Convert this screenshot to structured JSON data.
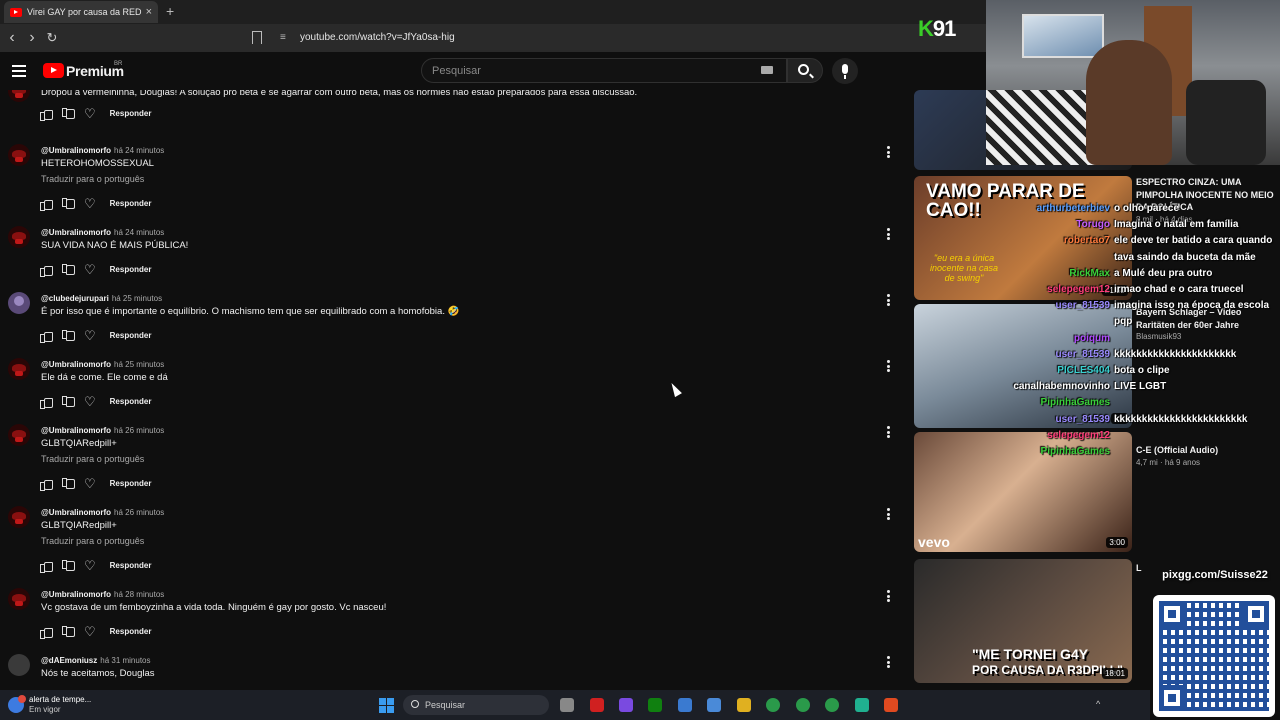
{
  "browser": {
    "tab_title": "Virei GAY por causa da REDPILL",
    "tab_close": "×",
    "new_tab": "+",
    "back": "‹",
    "forward": "›",
    "reload": "↻",
    "site_icon": "≡",
    "url": "youtube.com/watch?v=JfYa0sa-hig"
  },
  "youtube": {
    "brand": "Premium",
    "country": "BR",
    "search_placeholder": "Pesquisar"
  },
  "comments": [
    {
      "avatar": "red",
      "user": "",
      "time": "",
      "text": "Dropou a vermelhinha, Douglas! A solução pro beta é se agarrar com outro beta, mas os normies não estão preparados para essa discussão.",
      "translate": "",
      "reply": "Responder",
      "kebab": false
    },
    {
      "avatar": "red",
      "user": "@Umbralinomorfo",
      "time": "há 24 minutos",
      "text": "HETEROHOMOSSEXUAL",
      "translate": "Traduzir para o português",
      "reply": "Responder",
      "kebab": true
    },
    {
      "avatar": "red",
      "user": "@Umbralinomorfo",
      "time": "há 24 minutos",
      "text": "SUA VIDA NAO É MAIS PÚBLICA!",
      "translate": "",
      "reply": "Responder",
      "kebab": true
    },
    {
      "avatar": "purple",
      "user": "@clubedejurupari",
      "time": "há 25 minutos",
      "text": "É por isso que é importante o equilíbrio. O machismo tem que ser equilibrado com a homofobia. 🤣",
      "translate": "",
      "reply": "Responder",
      "kebab": true
    },
    {
      "avatar": "red",
      "user": "@Umbralinomorfo",
      "time": "há 25 minutos",
      "text": "Ele dá e come. Ele come e dá",
      "translate": "",
      "reply": "Responder",
      "kebab": true
    },
    {
      "avatar": "red",
      "user": "@Umbralinomorfo",
      "time": "há 26 minutos",
      "text": "GLBTQIARedpill+",
      "translate": "Traduzir para o português",
      "reply": "Responder",
      "kebab": true
    },
    {
      "avatar": "red",
      "user": "@Umbralinomorfo",
      "time": "há 26 minutos",
      "text": "GLBTQIARedpill+",
      "translate": "Traduzir para o português",
      "reply": "Responder",
      "kebab": true
    },
    {
      "avatar": "red",
      "user": "@Umbralinomorfo",
      "time": "há 28 minutos",
      "text": "Vc gostava de um femboyzinha a vida toda. Ninguém é gay por gosto. Vc nasceu!",
      "translate": "",
      "reply": "Responder",
      "kebab": true
    },
    {
      "avatar": "grey",
      "user": "@dAEmoniusz",
      "time": "há 31 minutos",
      "text": "Nós te aceitamos, Douglas",
      "translate": "",
      "reply": "",
      "kebab": true
    }
  ],
  "videos": [
    {
      "thumb_text": "G",
      "duration": "",
      "title": "",
      "meta": ""
    },
    {
      "thumb_text": "VAMO PARAR DE CAO!!",
      "quote": "\"eu era a única inocente na casa de swing\"",
      "duration": "21:39",
      "title": "ESPECTRO CINZA: UMA PIMPOLHA INOCENTE NO MEIO DA POLÍTICA",
      "meta": "8 mil · há 4 dias"
    },
    {
      "duration": "19:",
      "title": "Bayern Schlager – Video Raritäten der 60er Jahre",
      "meta": "Blasmusik93"
    },
    {
      "thumb_text": "vevo",
      "duration": "3:00",
      "title": "C-E (Official Audio)",
      "meta": "4,7 mi · há 9 anos"
    },
    {
      "thumb_text": "\"ME TORNEI G4Y",
      "thumb_text2": "POR CAUSA DA R3DPILL\"",
      "duration": "18:01",
      "title": "L",
      "meta": ""
    }
  ],
  "chat": [
    {
      "user": "arthurbeterbiev",
      "color": "#5aa0ff",
      "msg": "o olho parece"
    },
    {
      "user": "Torugo",
      "color": "#c45cff",
      "msg": "Imagina o natal em família"
    },
    {
      "user": "robertao7",
      "color": "#ff7a3d",
      "msg": "ele deve ter batido a cara quando"
    },
    {
      "user": "",
      "color": "#ffffff",
      "msg": "tava saindo da buceta da mãe"
    },
    {
      "user": "RickMax",
      "color": "#3ad13a",
      "msg": "a Mulé deu pra outro"
    },
    {
      "user": "selepegem12",
      "color": "#ff3d7a",
      "msg": "irmao chad e o cara truecel"
    },
    {
      "user": "user_81539",
      "color": "#9a8aff",
      "msg": "imagina isso na época da escola"
    },
    {
      "user": "",
      "color": "#ffffff",
      "msg": "pqp"
    },
    {
      "user": "poiqum",
      "color": "#b04aff",
      "msg": ""
    },
    {
      "user": "user_81539",
      "color": "#9a8aff",
      "msg": "kkkkkkkkkkkkkkkkkkkkkk"
    },
    {
      "user": "PICLES404",
      "color": "#3ad1d1",
      "msg": "bota o clipe"
    },
    {
      "user": "canalhabemnovinho",
      "color": "#ffffff",
      "msg": "LIVE LGBT"
    },
    {
      "user": "PipinhaGames",
      "color": "#3ad13a",
      "msg": ""
    },
    {
      "user": "user_81539",
      "color": "#9a8aff",
      "msg": "kkkkkkkkkkkkkkkkkkkkkkkk"
    },
    {
      "user": "selepegem12",
      "color": "#ff3d7a",
      "msg": ""
    },
    {
      "user": "PipinhaGames",
      "color": "#3ad13a",
      "msg": ""
    }
  ],
  "overlay": {
    "logo_k": "K",
    "logo_num": "91",
    "promo_url": "pixgg.com/Suisse22"
  },
  "taskbar": {
    "weather_title": "alerta de tempe...",
    "weather_sub": "Em vigor",
    "search_placeholder": "Pesquisar",
    "tray": "^"
  }
}
